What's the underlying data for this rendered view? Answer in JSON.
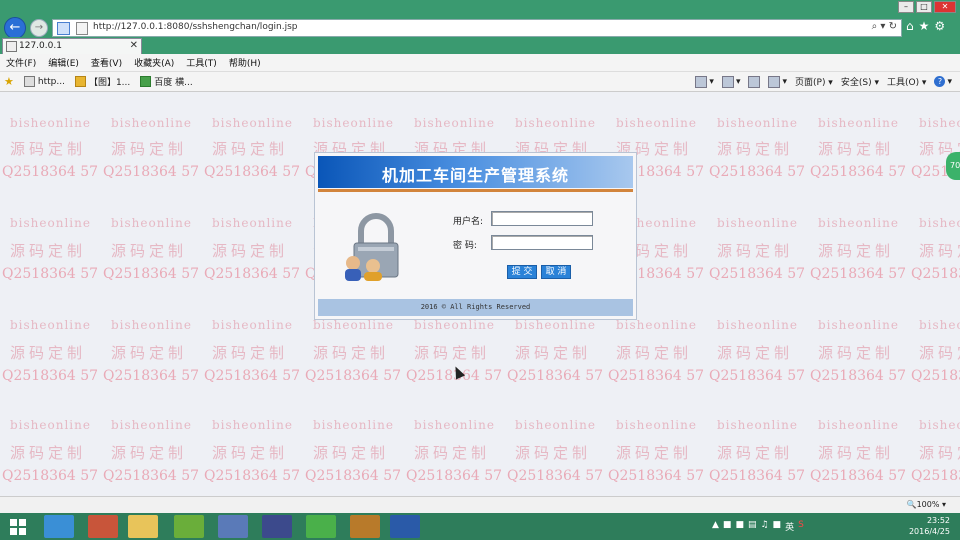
{
  "browser": {
    "url": "http://127.0.0.1:8080/sshshengchan/login.jsp",
    "tab_title": "127.0.0.1",
    "addr_tools": "⌕ ▾ ↻",
    "right_icons": [
      "home-icon",
      "favorites-star-icon",
      "settings-gear-icon"
    ],
    "window_controls": [
      "–",
      "□",
      "✕"
    ]
  },
  "menu": [
    "文件(F)",
    "编辑(E)",
    "查看(V)",
    "收藏夹(A)",
    "工具(T)",
    "帮助(H)"
  ],
  "favorites": [
    {
      "icon": "page-icon",
      "label": "http..."
    },
    {
      "icon": "slice-icon",
      "label": "【图】1..."
    },
    {
      "icon": "site-icon",
      "label": "百度 横..."
    }
  ],
  "toolbar_right": [
    "▾",
    "▾",
    "▾",
    "页面(P) ▾",
    "安全(S) ▾",
    "工具(O) ▾",
    "▾"
  ],
  "watermark": {
    "text_a": "bisheonline",
    "text_b": "源码定制",
    "text_c": "Q2518364 57"
  },
  "login": {
    "title": "机加工车间生产管理系统",
    "username_label": "用户名:",
    "password_label": "密  码:",
    "username_value": "",
    "password_value": "",
    "submit_label": "提 交",
    "cancel_label": "取 消",
    "footer": "2016 © All Rights Reserved"
  },
  "side_badge": "70",
  "status": {
    "zoom": "🔍100%  ▾"
  },
  "taskbar": {
    "time": "23:52",
    "date": "2016/4/25",
    "ime": "英",
    "apps": [
      "ie-icon",
      "store-icon",
      "explorer-icon",
      "app-green-icon",
      "remote-icon",
      "eclipse-icon",
      "browser-360-icon",
      "book-icon",
      "word-icon"
    ]
  },
  "colors": {
    "chrome_green": "#3a9a70",
    "header_blue": "#0a56b8",
    "button_blue": "#2a82d8",
    "watermark_pink": "#e6b8c4"
  }
}
